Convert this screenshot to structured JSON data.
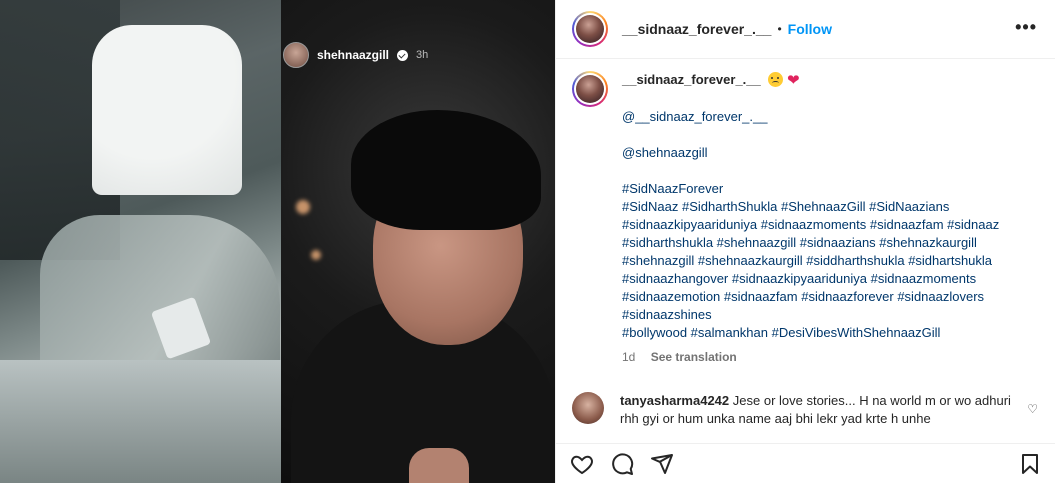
{
  "story": {
    "username": "shehnaazgill",
    "time": "3h"
  },
  "post": {
    "username": "__sidnaaz_forever_.__",
    "follow_label": "Follow",
    "separator": "•",
    "more_label": "•••"
  },
  "caption": {
    "username": "__sidnaaz_forever_.__",
    "mention1": "@__sidnaaz_forever_.__",
    "mention2": "@shehnaazgill",
    "tag_title": "#SidNaazForever",
    "tag_lines": [
      "#SidNaaz #SidharthShukla #ShehnaazGill #SidNaazians",
      "#sidnaazkipyaariduniya #sidnaazmoments #sidnaazfam #sidnaaz",
      "#sidharthshukla #shehnaazgill #sidnaazians #shehnazkaurgill",
      "#shehnazgill #shehnaazkaurgill #siddharthshukla #sidhartshukla",
      "#sidnaazhangover #sidnaazkipyaariduniya #sidnaazmoments",
      "#sidnaazemotion #sidnaazfam #sidnaazforever #sidnaazlovers",
      "#sidnaazshines",
      "#bollywood #salmankhan #DesiVibesWithShehnaazGill"
    ],
    "age": "1d",
    "see_translation": "See translation"
  },
  "comment": {
    "username": "tanyasharma4242",
    "text": "Jese or love stories... H na world m or wo adhuri rhh gyi or hum unka name aaj bhi lekr yad krte h unhe"
  },
  "icons": {
    "like": "heart-icon",
    "comment": "comment-icon",
    "share": "share-icon",
    "save": "bookmark-icon",
    "verified": "verified-badge-icon"
  },
  "colors": {
    "follow": "#0095f6",
    "link": "#00376b",
    "heart_emoji": "#e0245e"
  }
}
